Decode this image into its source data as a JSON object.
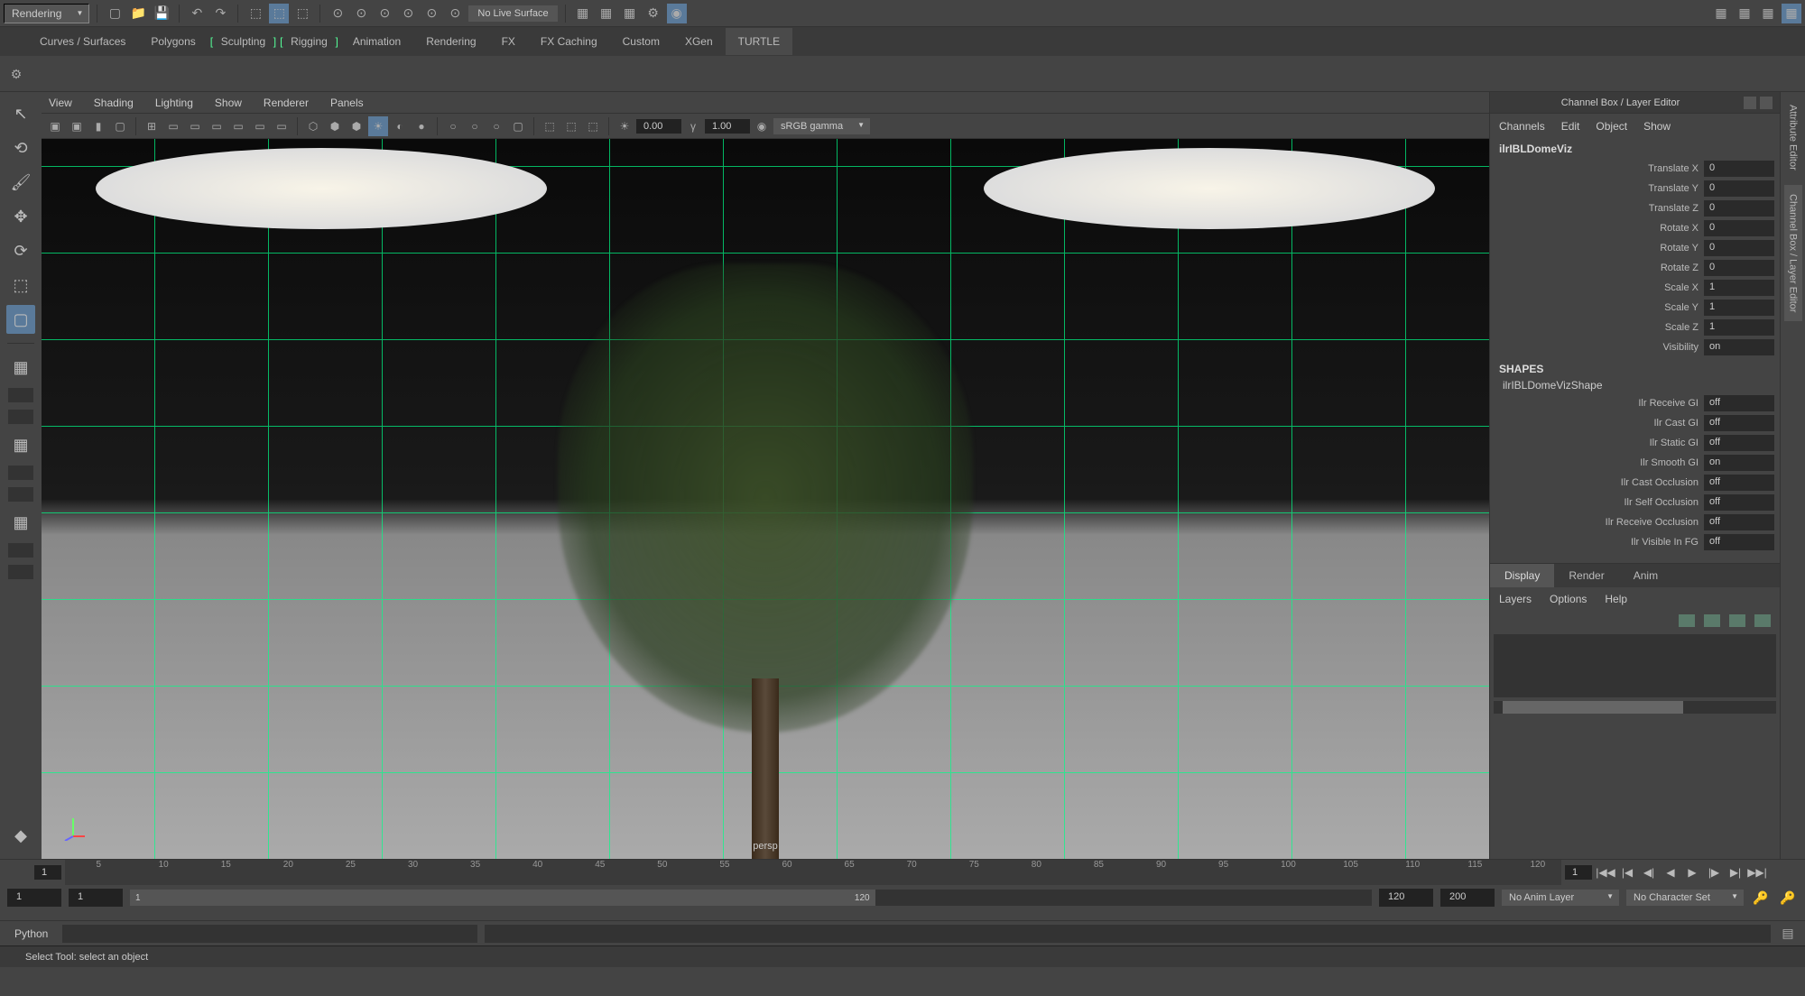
{
  "mode": "Rendering",
  "liveSurface": "No Live Surface",
  "shelfTabs": [
    "Curves / Surfaces",
    "Polygons",
    "Sculpting",
    "Rigging",
    "Animation",
    "Rendering",
    "FX",
    "FX Caching",
    "Custom",
    "XGen",
    "TURTLE"
  ],
  "activeShelf": "TURTLE",
  "vpMenus": [
    "View",
    "Shading",
    "Lighting",
    "Show",
    "Renderer",
    "Panels"
  ],
  "vpNear": "0.00",
  "vpFar": "1.00",
  "vpColorSpace": "sRGB gamma",
  "vpCamera": "persp",
  "rightPanel": {
    "title": "Channel Box / Layer Editor",
    "menus": [
      "Channels",
      "Edit",
      "Object",
      "Show"
    ],
    "objectName": "ilrIBLDomeViz",
    "channels": [
      {
        "label": "Translate X",
        "value": "0"
      },
      {
        "label": "Translate Y",
        "value": "0"
      },
      {
        "label": "Translate Z",
        "value": "0"
      },
      {
        "label": "Rotate X",
        "value": "0"
      },
      {
        "label": "Rotate Y",
        "value": "0"
      },
      {
        "label": "Rotate Z",
        "value": "0"
      },
      {
        "label": "Scale X",
        "value": "1"
      },
      {
        "label": "Scale Y",
        "value": "1"
      },
      {
        "label": "Scale Z",
        "value": "1"
      },
      {
        "label": "Visibility",
        "value": "on"
      }
    ],
    "shapesHeader": "SHAPES",
    "shapeName": "ilrIBLDomeVizShape",
    "shapeAttrs": [
      {
        "label": "Ilr Receive GI",
        "value": "off"
      },
      {
        "label": "Ilr Cast GI",
        "value": "off"
      },
      {
        "label": "Ilr Static GI",
        "value": "off"
      },
      {
        "label": "Ilr Smooth GI",
        "value": "on"
      },
      {
        "label": "Ilr Cast Occlusion",
        "value": "off"
      },
      {
        "label": "Ilr Self Occlusion",
        "value": "off"
      },
      {
        "label": "Ilr Receive Occlusion",
        "value": "off"
      },
      {
        "label": "Ilr Visible In FG",
        "value": "off"
      }
    ],
    "layerTabs": [
      "Display",
      "Render",
      "Anim"
    ],
    "activeLayerTab": "Display",
    "layerMenus": [
      "Layers",
      "Options",
      "Help"
    ]
  },
  "farRightTabs": [
    "Attribute Editor",
    "Channel Box / Layer Editor"
  ],
  "timeline": {
    "curFrame": "1",
    "endFrame": "1",
    "ticks": [
      "5",
      "10",
      "15",
      "20",
      "25",
      "30",
      "35",
      "40",
      "45",
      "50",
      "55",
      "60",
      "65",
      "70",
      "75",
      "80",
      "85",
      "90",
      "95",
      "100",
      "105",
      "110",
      "115",
      "120"
    ],
    "rangeStart": "1",
    "rangeInner": "1",
    "rangeSliderStart": "1",
    "rangeSliderEnd": "120",
    "rangeEnd": "120",
    "rangeMax": "200",
    "animLayer": "No Anim Layer",
    "charSet": "No Character Set"
  },
  "cmdLang": "Python",
  "helpText": "Select Tool: select an object"
}
